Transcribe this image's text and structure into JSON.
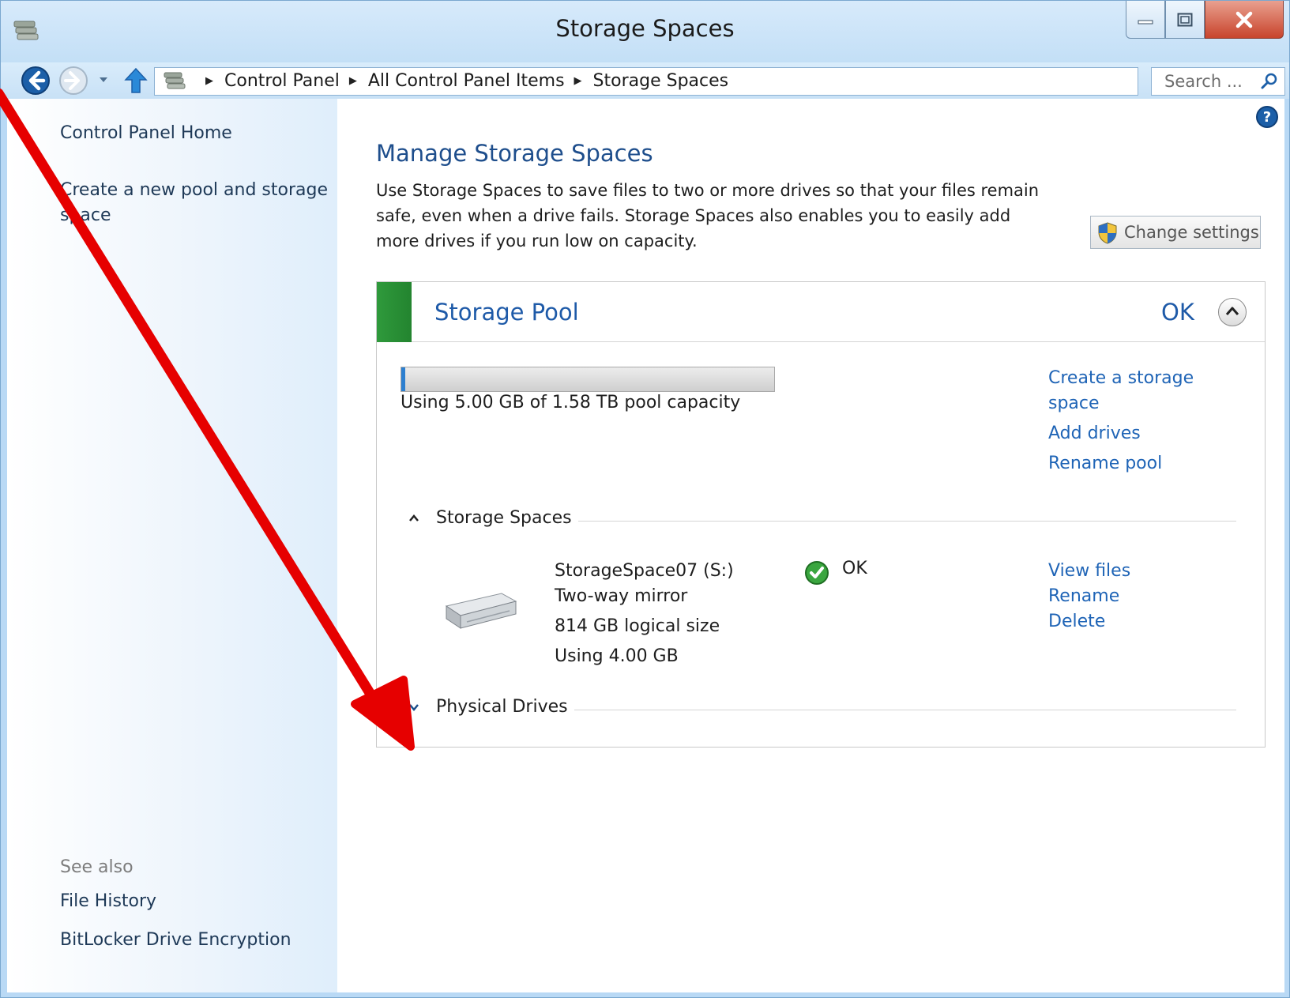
{
  "window": {
    "title": "Storage Spaces",
    "controls": {
      "minimize": "minimize",
      "maximize": "maximize",
      "close": "close"
    }
  },
  "address_bar": {
    "crumbs": [
      "Control Panel",
      "All Control Panel Items",
      "Storage Spaces"
    ],
    "search_placeholder": "Search ..."
  },
  "sidebar": {
    "home": "Control Panel Home",
    "create_pool": "Create a new pool and storage space",
    "see_also": "See also",
    "see_also_items": [
      "File History",
      "BitLocker Drive Encryption"
    ]
  },
  "main": {
    "title": "Manage Storage Spaces",
    "description": "Use Storage Spaces to save files to two or more drives so that your files remain safe, even when a drive fails. Storage Spaces also enables you to easily add more drives if you run low on capacity.",
    "change_settings": "Change settings"
  },
  "pool": {
    "title": "Storage Pool",
    "status": "OK",
    "capacity_text": "Using 5.00 GB of 1.58 TB pool capacity",
    "capacity_fraction": 0.003,
    "links": [
      "Create a storage space",
      "Add drives",
      "Rename pool"
    ],
    "sections": {
      "storage_spaces": "Storage Spaces",
      "physical_drives": "Physical Drives"
    },
    "space": {
      "name": "StorageSpace07 (S:)",
      "resiliency": "Two-way mirror",
      "size": "814 GB logical size",
      "usage": "Using 4.00 GB",
      "status": "OK",
      "links": [
        "View files",
        "Rename",
        "Delete"
      ]
    }
  },
  "colors": {
    "link": "#1f64b6",
    "heading": "#1e4e8c",
    "pool_ok": "#2f9a3c",
    "annotation_arrow": "#e60000"
  }
}
